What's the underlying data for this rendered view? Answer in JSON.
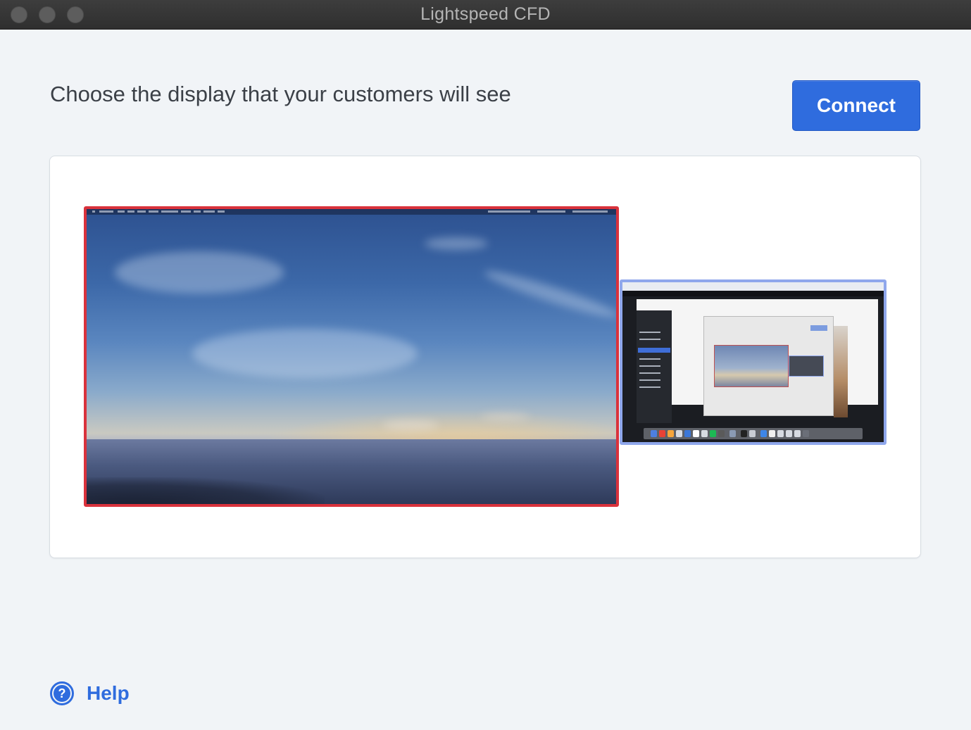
{
  "window": {
    "title": "Lightspeed CFD"
  },
  "main": {
    "heading": "Choose the display that your customers will see",
    "connect_label": "Connect"
  },
  "displays": [
    {
      "role": "primary",
      "selected": true,
      "border_color": "#d9323c"
    },
    {
      "role": "secondary",
      "selected": false,
      "border_color": "#8fa7ec"
    }
  ],
  "footer": {
    "help_label": "Help",
    "help_icon_glyph": "?",
    "help_icon": "question-circle-icon"
  },
  "colors": {
    "accent": "#2f6cde",
    "selected_display": "#d9323c",
    "background": "#f1f4f7"
  }
}
